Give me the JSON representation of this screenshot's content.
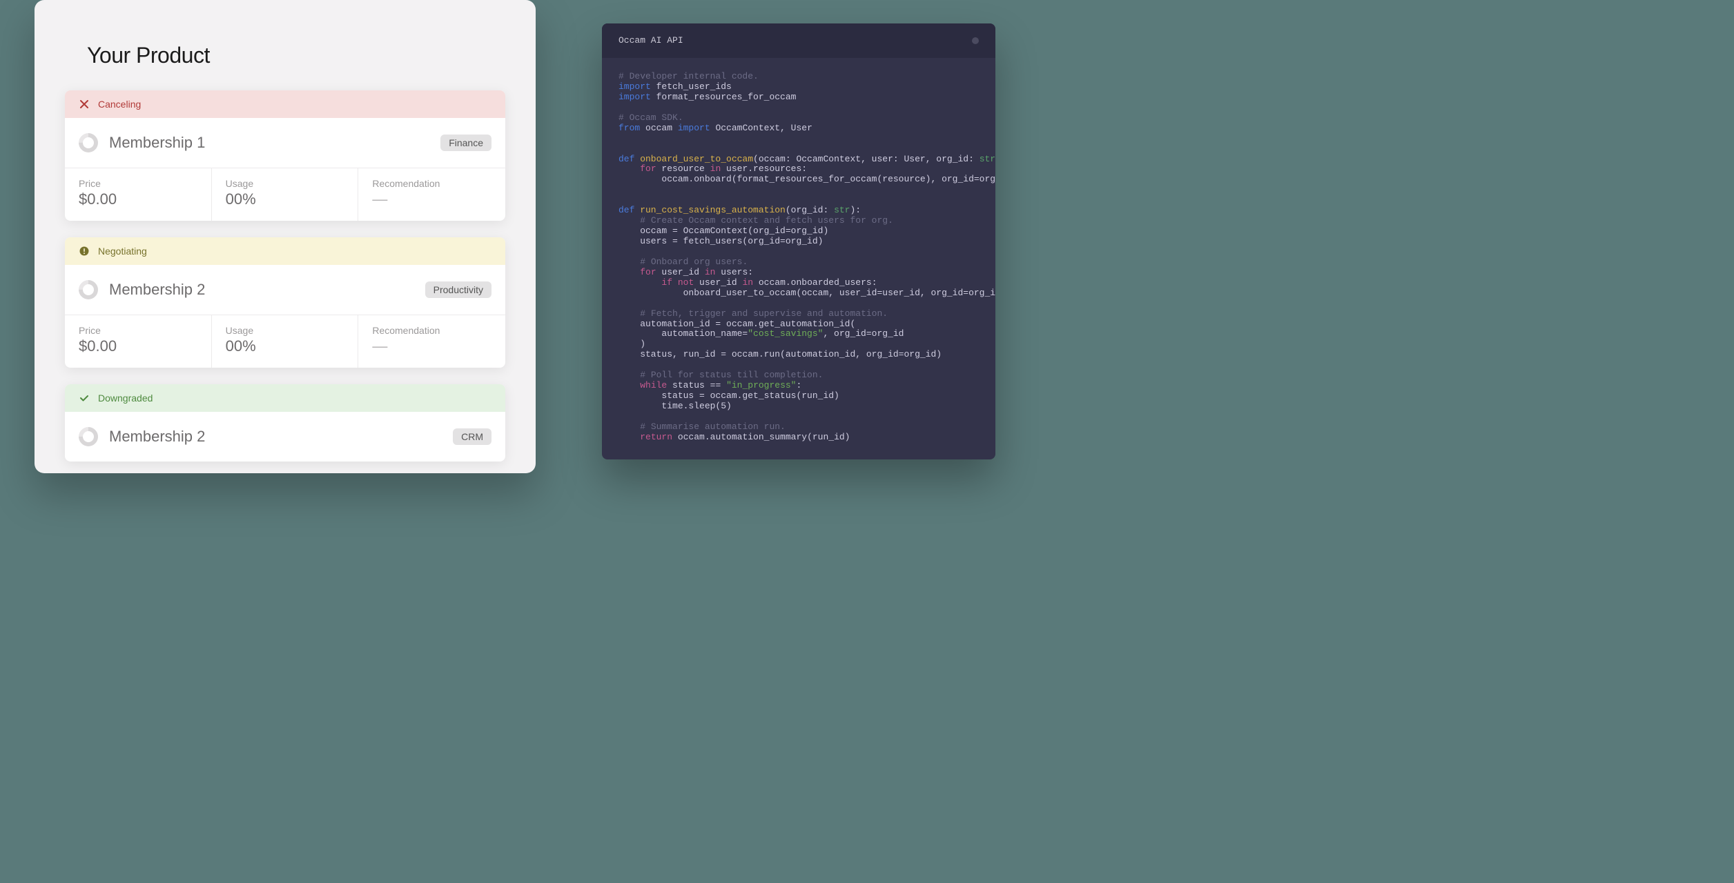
{
  "product": {
    "title": "Your Product",
    "memberships": [
      {
        "status_kind": "cancel",
        "status_label": "Canceling",
        "name": "Membership 1",
        "tag": "Finance",
        "price_label": "Price",
        "price_value": "$0.00",
        "usage_label": "Usage",
        "usage_value": "00%",
        "rec_label": "Recomendation",
        "rec_value": "—"
      },
      {
        "status_kind": "neg",
        "status_label": "Negotiating",
        "name": "Membership 2",
        "tag": "Productivity",
        "price_label": "Price",
        "price_value": "$0.00",
        "usage_label": "Usage",
        "usage_value": "00%",
        "rec_label": "Recomendation",
        "rec_value": "—"
      },
      {
        "status_kind": "down",
        "status_label": "Downgraded",
        "name": "Membership 2",
        "tag": "CRM"
      }
    ]
  },
  "code": {
    "title": "Occam AI API",
    "lines": {
      "c1": "# Developer internal code.",
      "imp": "import",
      "imp1b": " fetch_user_ids",
      "imp2b": " format_resources_for_occam",
      "c2": "# Occam SDK.",
      "from": "from",
      "frommid": " occam ",
      "fromimp": "import",
      "fromtail": " OccamContext, User",
      "def": "def",
      "fn1": " onboard_user_to_occam",
      "fn1sig_a": "(occam: OccamContext, user: User, org_id: ",
      "str": "str",
      "fn1sig_b": "):",
      "for": "for",
      "in": "in",
      "fn1l1": " resource ",
      "fn1l1b": " user.resources:",
      "fn1l2": "        occam.onboard(format_resources_for_occam(resource), org_id=org_id)",
      "fn2": " run_cost_savings_automation",
      "fn2sig_a": "(org_id: ",
      "fn2sig_b": "):",
      "c3": "# Create Occam context and fetch users for org.",
      "fn2l1": "    occam = OccamContext(org_id=org_id)",
      "fn2l2": "    users = fetch_users(org_id=org_id)",
      "c4": "# Onboard org users.",
      "fn2l3a": " user_id ",
      "fn2l3b": " users:",
      "if": "if",
      "not": "not",
      "fn2l4a": " user_id ",
      "fn2l4b": " occam.onboarded_users:",
      "fn2l5": "            onboard_user_to_occam(occam, user_id=user_id, org_id=org_id)",
      "c5": "# Fetch, trigger and supervise and automation.",
      "fn2l6": "    automation_id = occam.get_automation_id(",
      "fn2l7a": "        automation_name=",
      "fn2l7s": "\"cost_savings\"",
      "fn2l7b": ", org_id=org_id",
      "fn2l8": "    )",
      "fn2l9": "    status, run_id = occam.run(automation_id, org_id=org_id)",
      "c6": "# Poll for status till completion.",
      "while": "while",
      "fn2l10a": " status == ",
      "fn2l10s": "\"in_progress\"",
      "fn2l10b": ":",
      "fn2l11": "        status = occam.get_status(run_id)",
      "fn2l12": "        time.sleep(5)",
      "c7": "# Summarise automation run.",
      "return": "return",
      "fn2l13": " occam.automation_summary(run_id)"
    }
  }
}
